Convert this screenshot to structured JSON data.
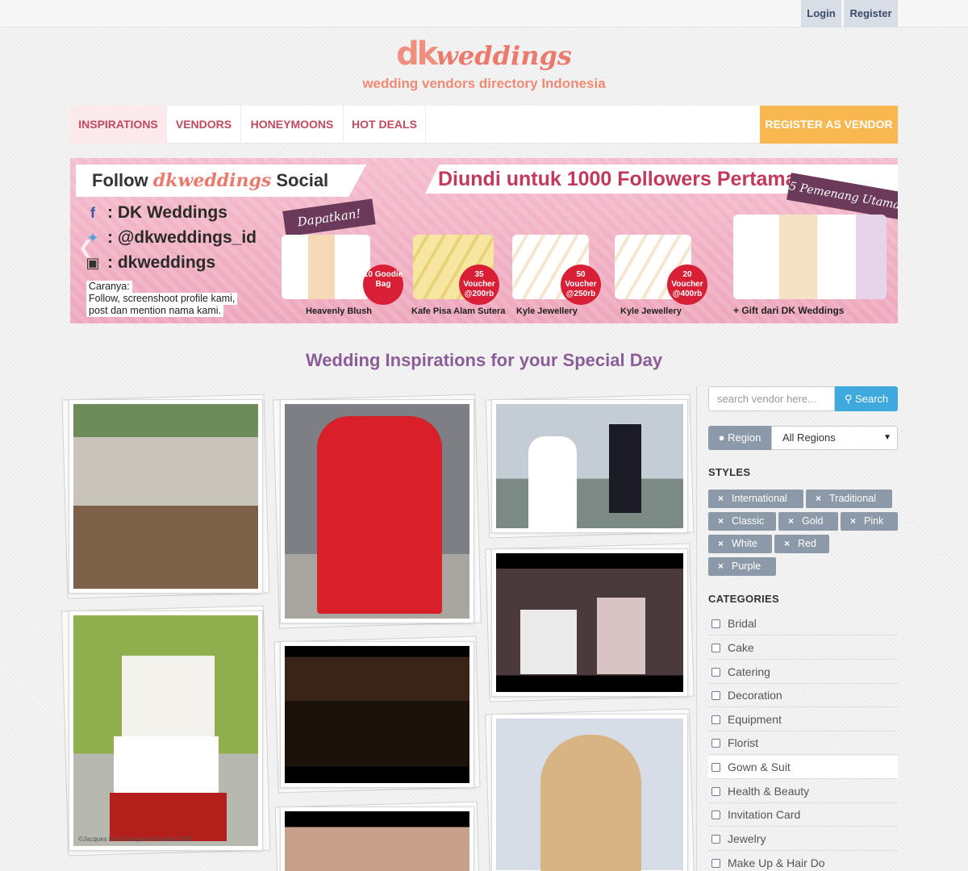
{
  "auth": {
    "login": "Login",
    "register": "Register"
  },
  "brand": {
    "logo_dk": "dk",
    "logo_weddings": "weddings",
    "tagline": "wedding vendors directory Indonesia"
  },
  "nav": {
    "items": [
      "INSPIRATIONS",
      "VENDORS",
      "HONEYMOONS",
      "HOT DEALS"
    ],
    "cta": "REGISTER AS VENDOR"
  },
  "banner": {
    "follow_prefix": "Follow",
    "follow_brand": "dkweddings",
    "follow_suffix": "Social Media",
    "headline": "Diundi untuk 1000 Followers Pertama",
    "social": [
      {
        "icon": "facebook-icon",
        "text": ": DK Weddings"
      },
      {
        "icon": "twitter-icon",
        "text": ": @dkweddings_id"
      },
      {
        "icon": "instagram-icon",
        "text": ": dkweddings"
      }
    ],
    "caranya": [
      "Caranya:",
      "Follow, screenshoot profile kami,",
      "post dan mention nama kami."
    ],
    "dapatkan": "Dapatkan!",
    "pemenang": "5 Pemenang Utama",
    "prizes": [
      {
        "badge": "10 Goodie Bag",
        "caption": "Heavenly Blush"
      },
      {
        "badge": "35 Voucher @200rb",
        "caption": "Kafe Pisa Alam Sutera"
      },
      {
        "badge": "50 Voucher @250rb",
        "caption": "Kyle Jewellery"
      },
      {
        "badge": "20 Voucher @400rb",
        "caption": "Kyle Jewellery"
      }
    ],
    "gift": "+ Gift dari DK Weddings",
    "colors": {
      "pink": "#f1b3c6",
      "badge": "#d81f36",
      "ribbon": "#6b3a5a",
      "headline": "#c2395c"
    }
  },
  "section_title": "Wedding Inspirations for your Special Day",
  "gallery": [
    {
      "name": "photo-mud-bride"
    },
    {
      "name": "photo-red-sedan-chair"
    },
    {
      "name": "photo-bride-groom-table"
    },
    {
      "name": "photo-noodle-box-cake",
      "caption": "©Jacques Fine European Pastries 2009"
    },
    {
      "name": "photo-dance-hall"
    },
    {
      "name": "photo-couple-reception"
    },
    {
      "name": "photo-hands"
    },
    {
      "name": "photo-bridal-hairstyle"
    }
  ],
  "sidebar": {
    "search_placeholder": "search vendor here...",
    "search_button": "Search",
    "region_label": "Region",
    "region_value": "All Regions",
    "styles_title": "STYLES",
    "styles": [
      "International",
      "Traditional",
      "Classic",
      "Gold",
      "Pink",
      "White",
      "Red",
      "Purple"
    ],
    "categories_title": "CATEGORIES",
    "categories": [
      "Bridal",
      "Cake",
      "Catering",
      "Decoration",
      "Equipment",
      "Florist",
      "Gown & Suit",
      "Health & Beauty",
      "Invitation Card",
      "Jewelry",
      "Make Up & Hair Do"
    ]
  },
  "colors": {
    "nav_text": "#c24a5e",
    "cta": "#f8b84f",
    "title": "#8a5d98",
    "search": "#3fa9dd",
    "tag": "#8c99a8"
  }
}
